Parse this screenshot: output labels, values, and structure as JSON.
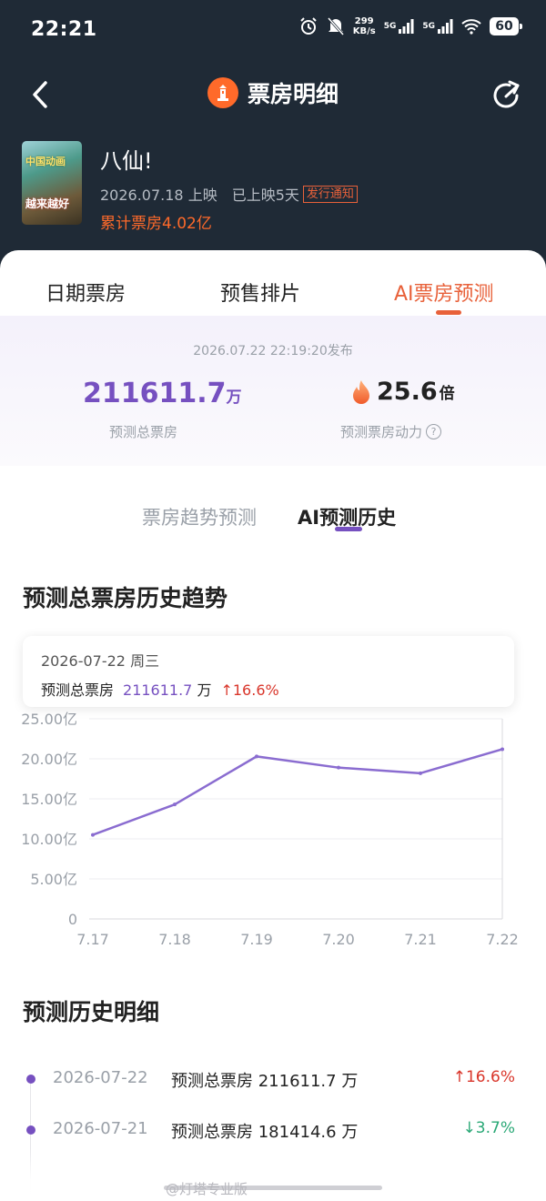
{
  "status_bar": {
    "time": "22:21",
    "net_speed_value": "299",
    "net_speed_unit": "KB/s",
    "sim1": "5G",
    "sim2": "5G",
    "battery": "60"
  },
  "nav": {
    "title": "票房明细",
    "back_icon": "chevron-left-icon",
    "share_icon": "share-icon"
  },
  "movie": {
    "title": "八仙!",
    "release": "2026.07.18 上映",
    "days": "已上映5天",
    "notice_badge": "发行通知",
    "cumulative": "累计票房4.02亿",
    "poster_text_1": "中国动画",
    "poster_text_2": "越来越好"
  },
  "tabs": [
    "日期票房",
    "预售排片",
    "AI票房预测"
  ],
  "active_tab": 2,
  "forecast": {
    "published": "2026.07.22 22:19:20发布",
    "total_value": "211611.7",
    "total_unit": "万",
    "total_label": "预测总票房",
    "momentum_value": "25.6",
    "momentum_unit": "倍",
    "momentum_label": "预测票房动力",
    "help_icon": "question-circle-icon",
    "flame_icon": "flame-icon"
  },
  "sub_tabs": [
    "票房趋势预测",
    "AI预测历史"
  ],
  "active_sub_tab": 1,
  "trend_section_title": "预测总票房历史趋势",
  "tooltip": {
    "date": "2026-07-22  周三",
    "label": "预测总票房",
    "value": "211611.7",
    "unit": "万",
    "change": "↑16.6%"
  },
  "chart_data": {
    "type": "line",
    "title": "预测总票房历史趋势",
    "x": [
      "7.17",
      "7.18",
      "7.19",
      "7.20",
      "7.21",
      "7.22"
    ],
    "series": [
      {
        "values": [
          10.5,
          14.3,
          20.3,
          18.9,
          18.2,
          21.2
        ]
      }
    ],
    "y_ticks": [
      "0",
      "5.00亿",
      "10.00亿",
      "15.00亿",
      "20.00亿",
      "25.00亿"
    ],
    "ylim": [
      0,
      25
    ],
    "grid": true,
    "line_color": "#8a6cd0"
  },
  "detail_section_title": "预测历史明细",
  "history": [
    {
      "date": "2026-07-22",
      "text": "预测总票房 211611.7 万",
      "change": "↑16.6%",
      "dir": "up"
    },
    {
      "date": "2026-07-21",
      "text": "预测总票房 181414.6 万",
      "change": "↓3.7%",
      "dir": "down"
    }
  ],
  "watermark": "@灯塔专业版",
  "colors": {
    "accent": "#e8613a",
    "purple": "#7650c0",
    "up": "#d9362b",
    "down": "#2aa876",
    "header_bg": "#1f2a36"
  }
}
